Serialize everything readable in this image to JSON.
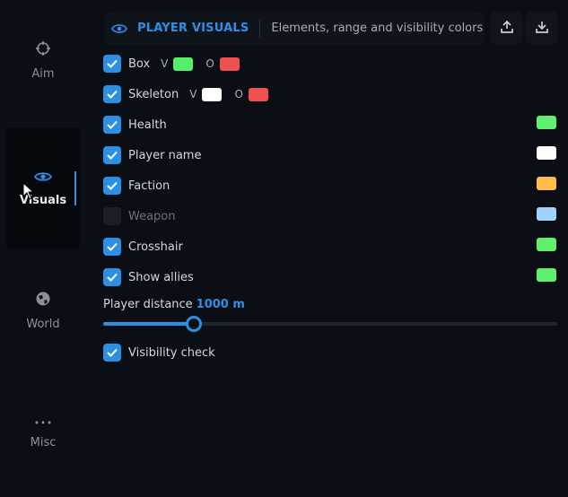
{
  "sidebar": {
    "items": [
      {
        "label": "Aim",
        "icon": "crosshair-icon"
      },
      {
        "label": "Visuals",
        "icon": "eye-icon"
      },
      {
        "label": "World",
        "icon": "globe-icon"
      },
      {
        "label": "Misc",
        "icon": "more-icon"
      }
    ]
  },
  "header": {
    "title": "PLAYER VISUALS",
    "subtitle": "Elements, range and visibility colors"
  },
  "options": [
    {
      "label": "Box",
      "checked": true,
      "v_label": "V",
      "o_label": "O",
      "v_color": "#55f06a",
      "o_color": "#f05050"
    },
    {
      "label": "Skeleton",
      "checked": true,
      "v_label": "V",
      "o_label": "O",
      "v_color": "#ffffff",
      "o_color": "#f05050"
    },
    {
      "label": "Health",
      "checked": true,
      "color": "#5ff06c"
    },
    {
      "label": "Player name",
      "checked": true,
      "color": "#ffffff"
    },
    {
      "label": "Faction",
      "checked": true,
      "color": "#fdbd48"
    },
    {
      "label": "Weapon",
      "checked": false,
      "color": "#9fd3fb"
    },
    {
      "label": "Crosshair",
      "checked": true,
      "color": "#5ff06c"
    },
    {
      "label": "Show allies",
      "checked": true,
      "color": "#5ff06c"
    }
  ],
  "distance": {
    "label": "Player distance",
    "value_text": "1000 m",
    "fraction": 0.2
  },
  "visibility_check": {
    "label": "Visibility check",
    "checked": true
  },
  "colors": {
    "accent": "#2f8ee6",
    "background": "#0b0f15"
  }
}
